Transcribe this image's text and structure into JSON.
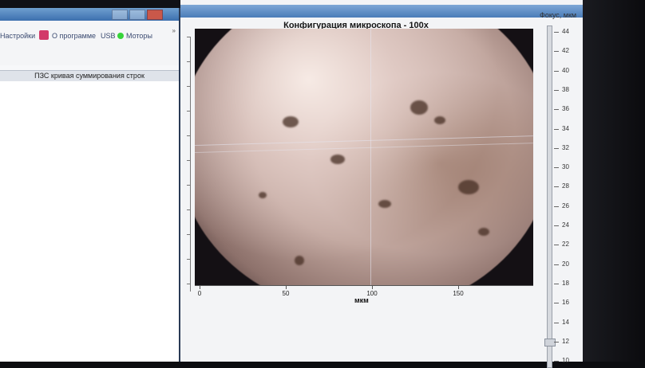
{
  "left_window": {
    "menu": {
      "settings_label": "Настройки",
      "about_label": "О программе",
      "usb_label": "USB",
      "motors_label": "Моторы",
      "usb_status_color": "#37d43a",
      "overflow_icon": "chevron-right-double-icon"
    },
    "panel_title": "ПЗС кривая суммирования строк"
  },
  "microscope": {
    "title": "Конфигурация микроскопа - 100х",
    "x_axis_label": "мкм",
    "x_ticks": [
      "0",
      "50",
      "100",
      "150"
    ]
  },
  "focus": {
    "label": "Фокус, мкм",
    "ticks": [
      "44",
      "42",
      "40",
      "38",
      "36",
      "34",
      "32",
      "30",
      "28",
      "26",
      "24",
      "22",
      "20",
      "18",
      "16",
      "14",
      "12",
      "10"
    ],
    "value": 12
  },
  "colors": {
    "titlebar": "#4a7cb8",
    "menu_text": "#3a4a70",
    "about_icon": "#d23a6a"
  }
}
